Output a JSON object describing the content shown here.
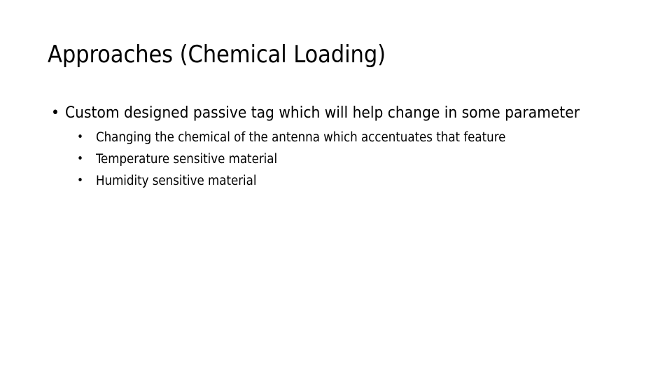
{
  "slide": {
    "title": "Approaches (Chemical Loading)",
    "bullet_marker": "•",
    "text_color": "#000000",
    "background_color": "#ffffff",
    "content": [
      {
        "level": 1,
        "text": "Custom designed passive tag which will help change in some parameter",
        "children": [
          {
            "level": 2,
            "text": "Changing the chemical of the antenna which accentuates that feature"
          },
          {
            "level": 2,
            "text": "Temperature sensitive material"
          },
          {
            "level": 2,
            "text": "Humidity sensitive material"
          }
        ]
      }
    ]
  }
}
